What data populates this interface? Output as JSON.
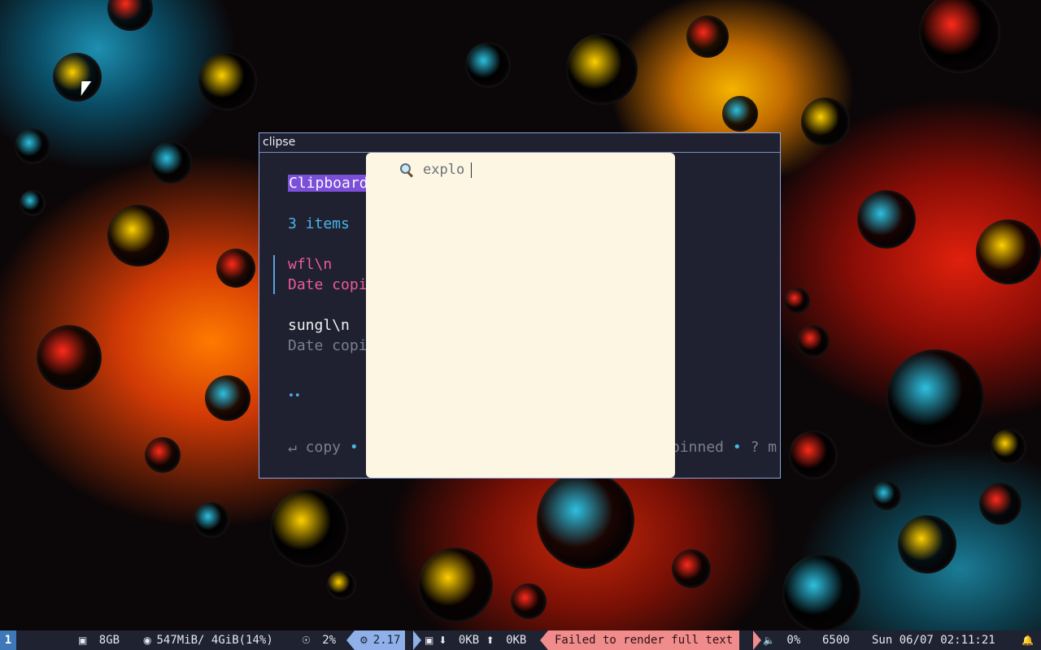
{
  "window": {
    "title": "clipse"
  },
  "clipse": {
    "header": "Clipboard",
    "count": "3 items",
    "items": [
      {
        "text": "wfl\\n",
        "meta": "Date copi"
      },
      {
        "text": "sungl\\n",
        "meta": "Date copi"
      }
    ],
    "pager": "••",
    "help_left": "↵ copy",
    "help_sep": "•",
    "help_right_a": "pinned",
    "help_right_b": "? m"
  },
  "search": {
    "value": "explo",
    "icon": "search-icon"
  },
  "statusbar": {
    "workspace": "1",
    "disk": "8GB",
    "memory": "547MiB/ 4GiB(14%)",
    "cpu_usage": "2%",
    "load": "2.17",
    "net_down": "0KB",
    "net_up": "0KB",
    "warning": "Failed to render full text",
    "volume": "0%",
    "temperature": "6500",
    "datetime": "Sun 06/07 02:11:21",
    "colors": {
      "workspace": "#3e78b8",
      "load": "#8fb0e8",
      "warning": "#f08c8c"
    }
  }
}
